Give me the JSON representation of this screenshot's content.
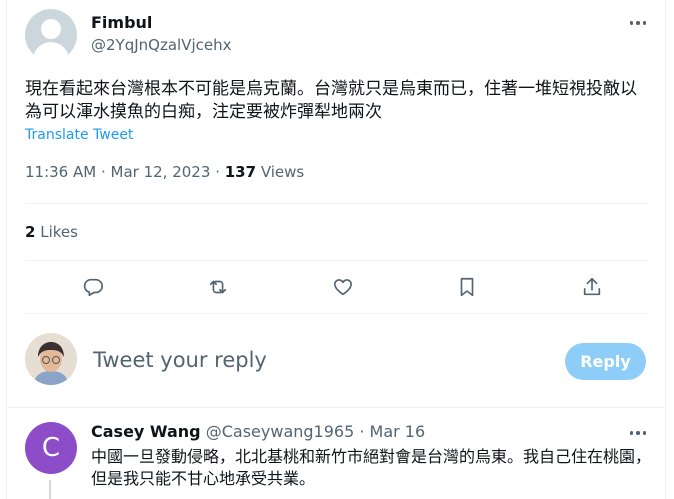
{
  "tweet": {
    "author_name": "Fimbul",
    "author_handle": "@2YqJnQzalVjcehx",
    "text": "現在看起來台灣根本不可能是烏克蘭。台灣就只是烏東而已，住著一堆短視投敵以為可以渾水摸魚的白痴，注定要被炸彈犁地兩次",
    "translate_label": "Translate Tweet",
    "time": "11:36 AM",
    "date": "Mar 12, 2023",
    "views_count": "137",
    "views_label": "Views",
    "likes_count": "2",
    "likes_label": "Likes"
  },
  "actions": {
    "reply_icon": "reply-icon",
    "retweet_icon": "retweet-icon",
    "like_icon": "heart-icon",
    "bookmark_icon": "bookmark-icon",
    "share_icon": "share-icon"
  },
  "composer": {
    "placeholder": "Tweet your reply",
    "reply_button": "Reply"
  },
  "reply": {
    "avatar_letter": "C",
    "author_name": "Casey Wang",
    "author_handle": "@Caseywang1965",
    "date": "Mar 16",
    "text": "中國一旦發動侵略，北北基桃和新竹市絕對會是台灣的烏東。我自己住在桃園，但是我只能不甘心地承受共業。"
  },
  "colors": {
    "accent": "#1d9bf0",
    "reply_button_disabled": "#8ecdf8",
    "secondary_text": "#536471",
    "divider": "#eff3f4",
    "reply_avatar_bg": "#8e4dc8"
  }
}
